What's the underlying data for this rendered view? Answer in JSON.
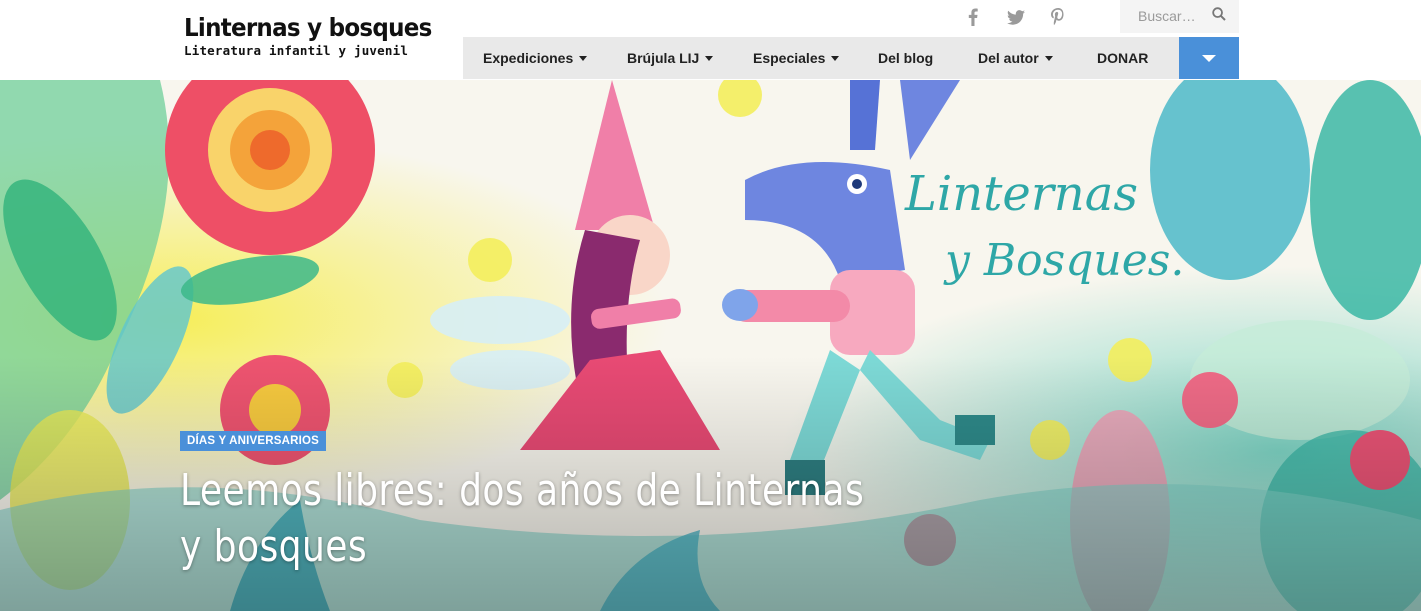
{
  "site": {
    "title": "Linternas y bosques",
    "subtitle": "Literatura infantil y juvenil"
  },
  "social": {
    "icons": [
      "facebook-icon",
      "twitter-icon",
      "pinterest-icon"
    ],
    "icon_color": "#9a9a9a"
  },
  "search": {
    "placeholder": "Buscar…",
    "value": ""
  },
  "nav": {
    "items": [
      {
        "label": "Expediciones",
        "has_dropdown": true
      },
      {
        "label": "Brújula LIJ",
        "has_dropdown": true
      },
      {
        "label": "Especiales",
        "has_dropdown": true
      },
      {
        "label": "Del blog",
        "has_dropdown": false
      },
      {
        "label": "Del autor",
        "has_dropdown": true
      },
      {
        "label": "DONAR",
        "has_dropdown": false
      }
    ],
    "toggle_icon": "chevron-down-icon",
    "background": "#e9e9e9",
    "accent": "#4a90d9"
  },
  "hero": {
    "category": "DÍAS Y ANIVERSARIOS",
    "title": "Leemos libres: dos años de Linternas y bosques",
    "artwork_lettering": "Linternas y Bosques.",
    "badge_color": "#4a90d9"
  }
}
